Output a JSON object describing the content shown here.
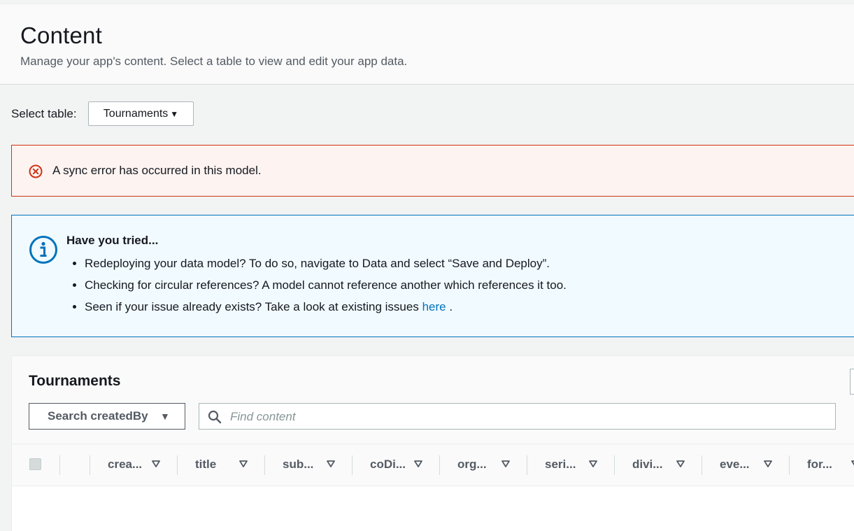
{
  "header": {
    "title": "Content",
    "subtitle": "Manage your app's content. Select a table to view and edit your app data."
  },
  "table_select": {
    "label": "Select table:",
    "value": "Tournaments"
  },
  "error_alert": {
    "message": "A sync error has occurred in this model."
  },
  "info_alert": {
    "title": "Have you tried...",
    "items": [
      "Redeploying your data model? To do so, navigate to Data and select “Save and Deploy”.",
      "Checking for circular references? A model cannot reference another which references it too.",
      "Seen if your issue already exists? Take a look at existing issues "
    ],
    "link_text": "here",
    "link_suffix": " ."
  },
  "table": {
    "title": "Tournaments",
    "search_by_label": "Search createdBy",
    "search_placeholder": "Find content",
    "columns": [
      "crea...",
      "title",
      "sub...",
      "coDi...",
      "org...",
      "seri...",
      "divi...",
      "eve...",
      "for..."
    ]
  },
  "colors": {
    "error": "#d13212",
    "info": "#0073bb",
    "link": "#0073bb"
  }
}
